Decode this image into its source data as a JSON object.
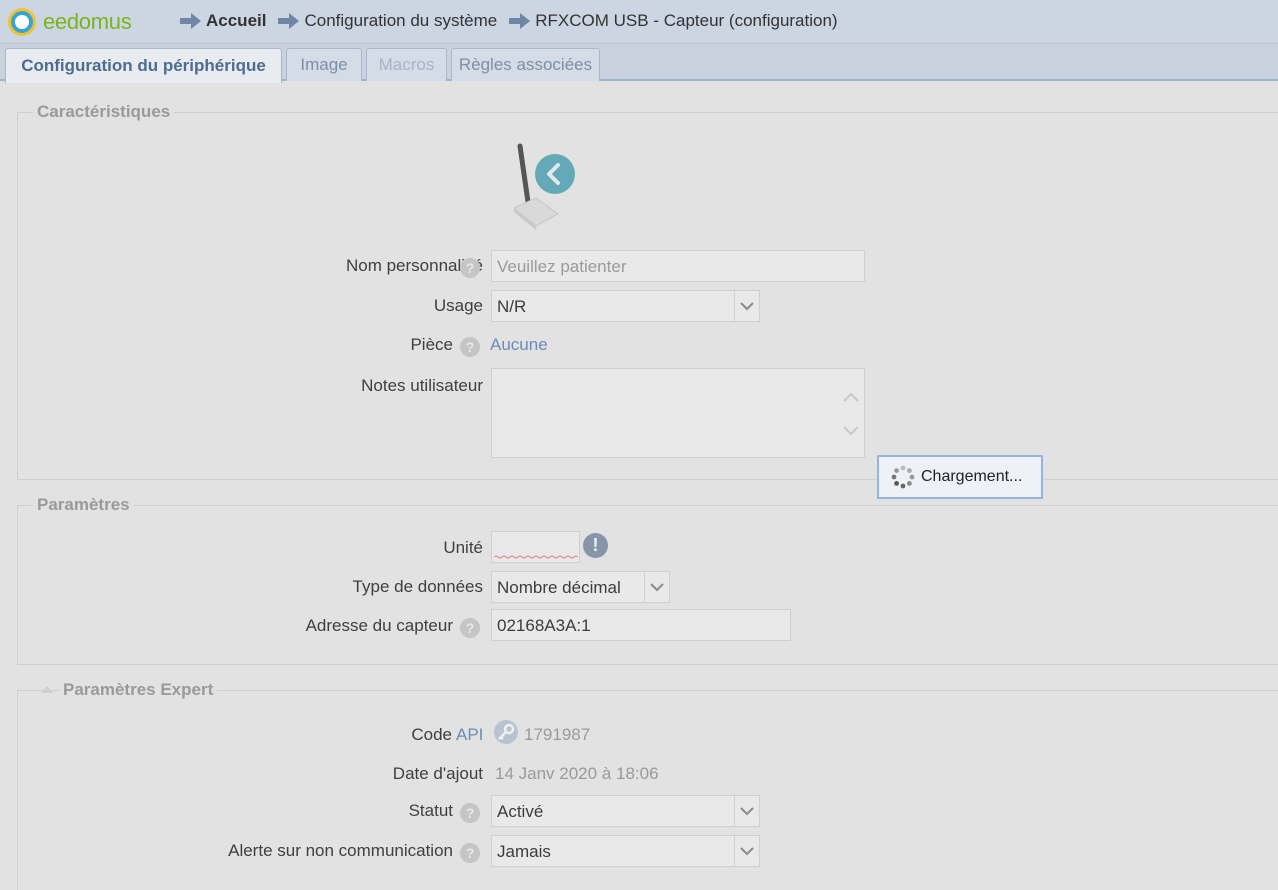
{
  "header": {
    "logo_text": "eedomus",
    "breadcrumbs": [
      "Accueil",
      "Configuration du système",
      "RFXCOM USB - Capteur (configuration)"
    ]
  },
  "tabs": [
    {
      "label": "Configuration du périphérique",
      "state": "active"
    },
    {
      "label": "Image",
      "state": "normal"
    },
    {
      "label": "Macros",
      "state": "disabled"
    },
    {
      "label": "Règles associées",
      "state": "normal"
    }
  ],
  "caracteristiques": {
    "legend": "Caractéristiques",
    "nom_label": "Nom personnalisé",
    "nom_placeholder": "Veuillez patienter",
    "usage_label": "Usage",
    "usage_value": "N/R",
    "piece_label": "Pièce",
    "piece_value": "Aucune",
    "notes_label": "Notes utilisateur",
    "notes_value": ""
  },
  "loader": {
    "label": "Chargement..."
  },
  "parametres": {
    "legend": "Paramètres",
    "unite_label": "Unité",
    "unite_value": "",
    "type_label": "Type de données",
    "type_value": "Nombre décimal",
    "adresse_label": "Adresse du capteur",
    "adresse_value": "02168A3A:1"
  },
  "expert": {
    "legend": "Paramètres Expert",
    "code_label": "Code",
    "code_link": "API",
    "code_value": "1791987",
    "date_label": "Date d'ajout",
    "date_value": "14 Janv 2020 à 18:06",
    "statut_label": "Statut",
    "statut_value": "Activé",
    "alerte_label": "Alerte sur non communication",
    "alerte_value": "Jamais"
  },
  "colors": {
    "accent": "#6b8cb6",
    "header_bg": "#ccd5e2",
    "logo_green": "#7ab51d"
  },
  "icons": [
    "arrow-right-icon",
    "help-icon",
    "chevron-down-icon",
    "warning-icon",
    "key-icon",
    "spinner-icon",
    "device-antenna-icon",
    "back-icon"
  ]
}
